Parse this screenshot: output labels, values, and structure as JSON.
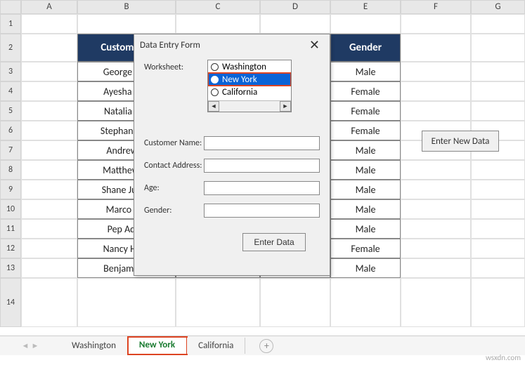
{
  "columns": [
    "A",
    "B",
    "C",
    "D",
    "E",
    "F",
    "G"
  ],
  "rows": [
    "1",
    "2",
    "3",
    "4",
    "5",
    "6",
    "7",
    "8",
    "9",
    "10",
    "11",
    "12",
    "13",
    "14"
  ],
  "header": {
    "name": "Customer N",
    "gender": "Gender"
  },
  "data": [
    {
      "name": "George Atki",
      "gender": "Male"
    },
    {
      "name": "Ayesha Mel",
      "gender": "Female"
    },
    {
      "name": "Natalia Aus",
      "gender": "Female"
    },
    {
      "name": "Stephanie Or",
      "gender": "Female"
    },
    {
      "name": "Andrew Fi",
      "gender": "Male"
    },
    {
      "name": "Matthew Ar",
      "gender": "Male"
    },
    {
      "name": "Shane Jugen",
      "gender": "Male"
    },
    {
      "name": "Marco Ver",
      "gender": "Male"
    },
    {
      "name": "Pep Adria",
      "gender": "Male"
    },
    {
      "name": "Nancy Hans",
      "gender": "Female"
    },
    {
      "name": "Benjamin H",
      "gender": "Male"
    }
  ],
  "dialog": {
    "title": "Data Entry Form",
    "ws_label": "Worksheet:",
    "worksheets": [
      "Washington",
      "New York",
      "California"
    ],
    "selected": "New York",
    "fields": {
      "customer": "Customer Name:",
      "address": "Contact Address:",
      "age": "Age:",
      "gender": "Gender:"
    },
    "enter_btn": "Enter Data"
  },
  "new_data_btn": "Enter New Data",
  "tabs": [
    "Washington",
    "New York",
    "California"
  ],
  "active_tab": "New York",
  "watermark": "wsxdn.com"
}
